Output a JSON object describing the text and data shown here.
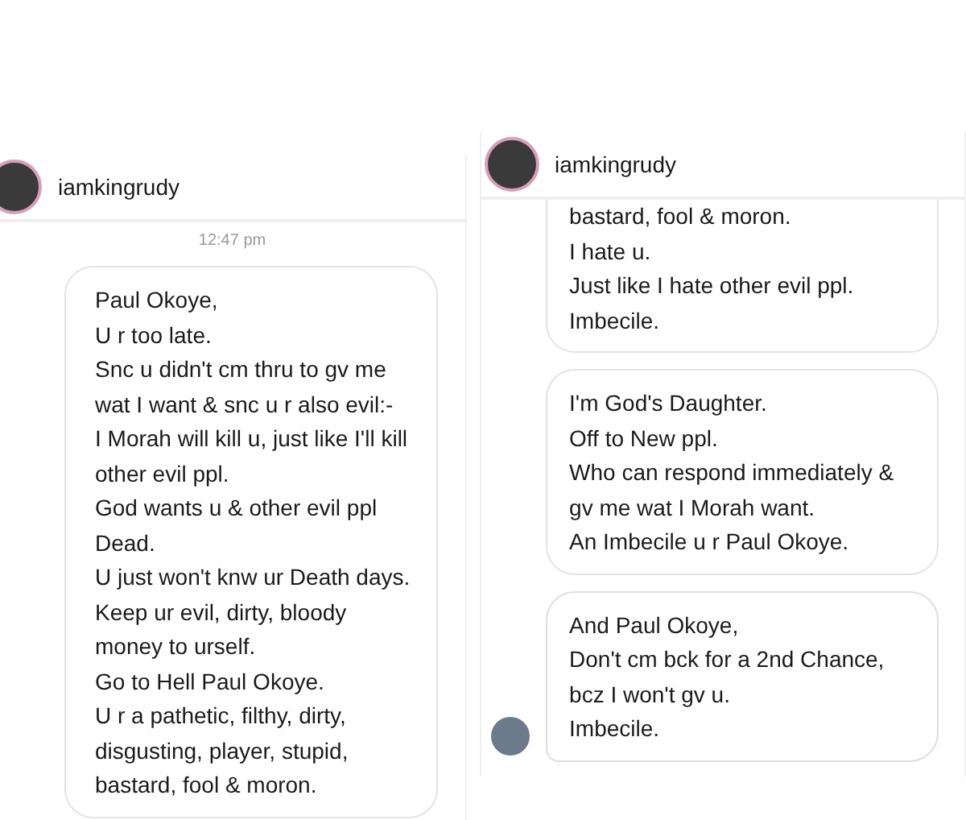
{
  "panels": [
    {
      "header": {
        "username": "iamkingrudy"
      },
      "timestamp": "12:47 pm",
      "messages": [
        {
          "lines": [
            "Paul Okoye,",
            "U r too late.",
            "Snc u didn't cm thru to gv me wat I want & snc u r also evil:-",
            "I Morah will kill u, just like I'll kill other evil ppl.",
            "God wants u & other evil ppl Dead.",
            "U just won't knw ur Death days.",
            "Keep ur evil, dirty, bloody money to urself.",
            "Go to Hell Paul Okoye.",
            "U r a pathetic, filthy, dirty, disgusting, player, stupid, bastard, fool & moron."
          ],
          "cut_top": false,
          "sender_avatar": false
        }
      ]
    },
    {
      "header": {
        "username": "iamkingrudy"
      },
      "messages": [
        {
          "lines": [
            "bastard, fool & moron.",
            "I hate u.",
            "Just like I hate other evil ppl.",
            "Imbecile."
          ],
          "cut_top": true,
          "sender_avatar": false
        },
        {
          "lines": [
            "I'm God's Daughter.",
            "Off to New ppl.",
            "Who can respond immediately & gv me wat I Morah want.",
            "An Imbecile u r Paul Okoye."
          ],
          "cut_top": false,
          "sender_avatar": false
        },
        {
          "lines": [
            "And Paul Okoye,",
            "Don't cm bck for a 2nd Chance, bcz I won't gv u.",
            "Imbecile."
          ],
          "cut_top": false,
          "sender_avatar": true
        }
      ]
    }
  ]
}
